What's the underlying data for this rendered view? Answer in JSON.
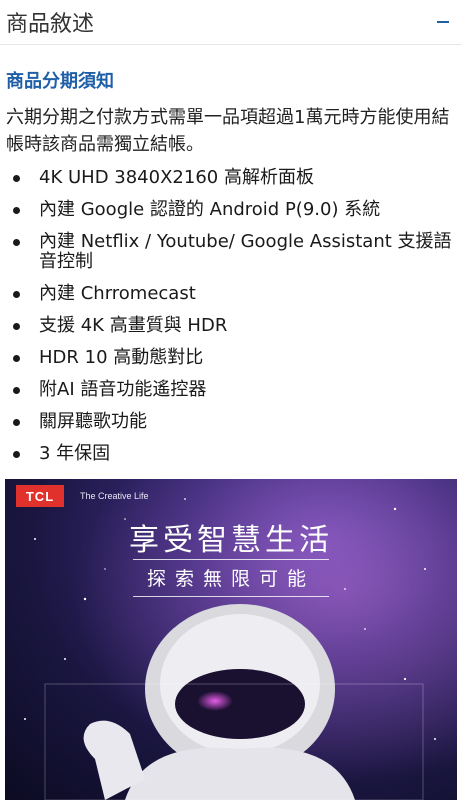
{
  "header": {
    "title": "商品敘述",
    "collapse_icon": "minus-icon"
  },
  "notice": {
    "title": "商品分期須知",
    "body": "六期分期之付款方式需單一品項超過1萬元時方能使用結帳時該商品需獨立結帳。"
  },
  "features": [
    "4K UHD 3840X2160 高解析面板",
    "內建 Google 認證的 Android P(9.0) 系統",
    "內建 Netflix / Youtube/ Google Assistant 支援語音控制",
    "內建 Chrromecast",
    "支援 4K 高畫質與 HDR",
    "HDR 10 高動態對比",
    "附AI 語音功能遙控器",
    "關屏聽歌功能",
    "3 年保固"
  ],
  "banner": {
    "brand": "TCL",
    "tagline": "The Creative Life",
    "headline": "享受智慧生活",
    "subheadline": "探索無限可能"
  },
  "colors": {
    "accent": "#1f5fa8",
    "brand_red": "#e0312d"
  }
}
